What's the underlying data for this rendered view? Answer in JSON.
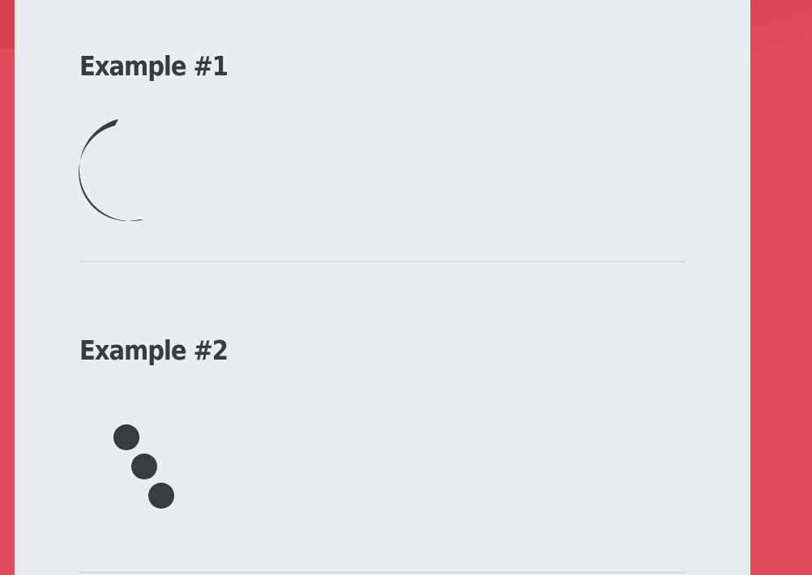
{
  "examples": [
    {
      "title": "Example #1",
      "loader": "arc-spinner"
    },
    {
      "title": "Example #2",
      "loader": "bouncing-dots"
    }
  ],
  "colors": {
    "background": "#e24b5e",
    "panel": "#e8edf2",
    "text": "#373c40",
    "loader": "#373c40",
    "divider": "#d7dbdf"
  }
}
